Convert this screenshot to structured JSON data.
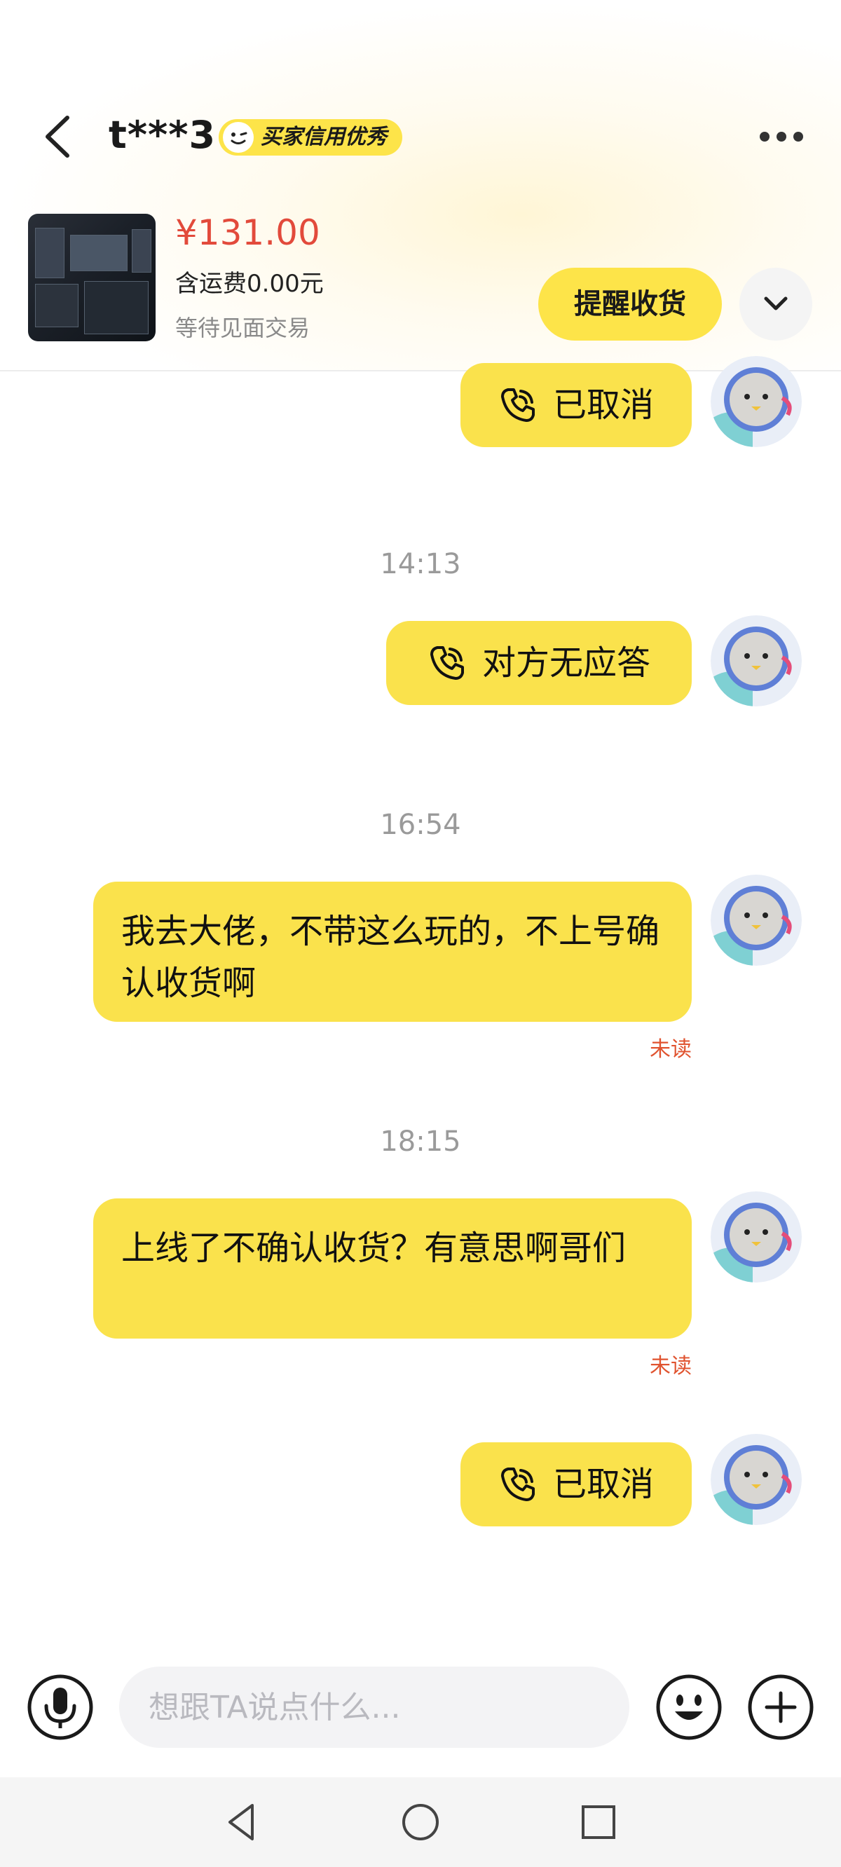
{
  "header": {
    "user_name": "t***3",
    "credit_badge": "买家信用优秀",
    "product": {
      "price": "¥131.00",
      "shipping": "含运费0.00元",
      "status": "等待见面交易"
    },
    "remind_button": "提醒收货"
  },
  "messages": [
    {
      "type": "call",
      "text": "已取消"
    },
    {
      "type": "time",
      "text": "14:13"
    },
    {
      "type": "call",
      "text": "对方无应答"
    },
    {
      "type": "time",
      "text": "16:54"
    },
    {
      "type": "text",
      "text": "我去大佬，不带这么玩的，不上号确认收货啊",
      "status": "未读"
    },
    {
      "type": "time",
      "text": "18:15"
    },
    {
      "type": "text",
      "text": "上线了不确认收货？有意思啊哥们",
      "status": "未读"
    },
    {
      "type": "call",
      "text": "已取消"
    }
  ],
  "input": {
    "placeholder": "想跟TA说点什么..."
  },
  "colors": {
    "bubble": "#fae24c",
    "price": "#e24a3b",
    "unread": "#e0532f",
    "badge": "#fde449"
  },
  "icons": {
    "back": "chevron-left-icon",
    "more": "more-dots-icon",
    "expand": "chevron-down-icon",
    "call": "phone-icon",
    "mic": "microphone-icon",
    "emoji": "emoji-icon",
    "plus": "plus-icon"
  }
}
